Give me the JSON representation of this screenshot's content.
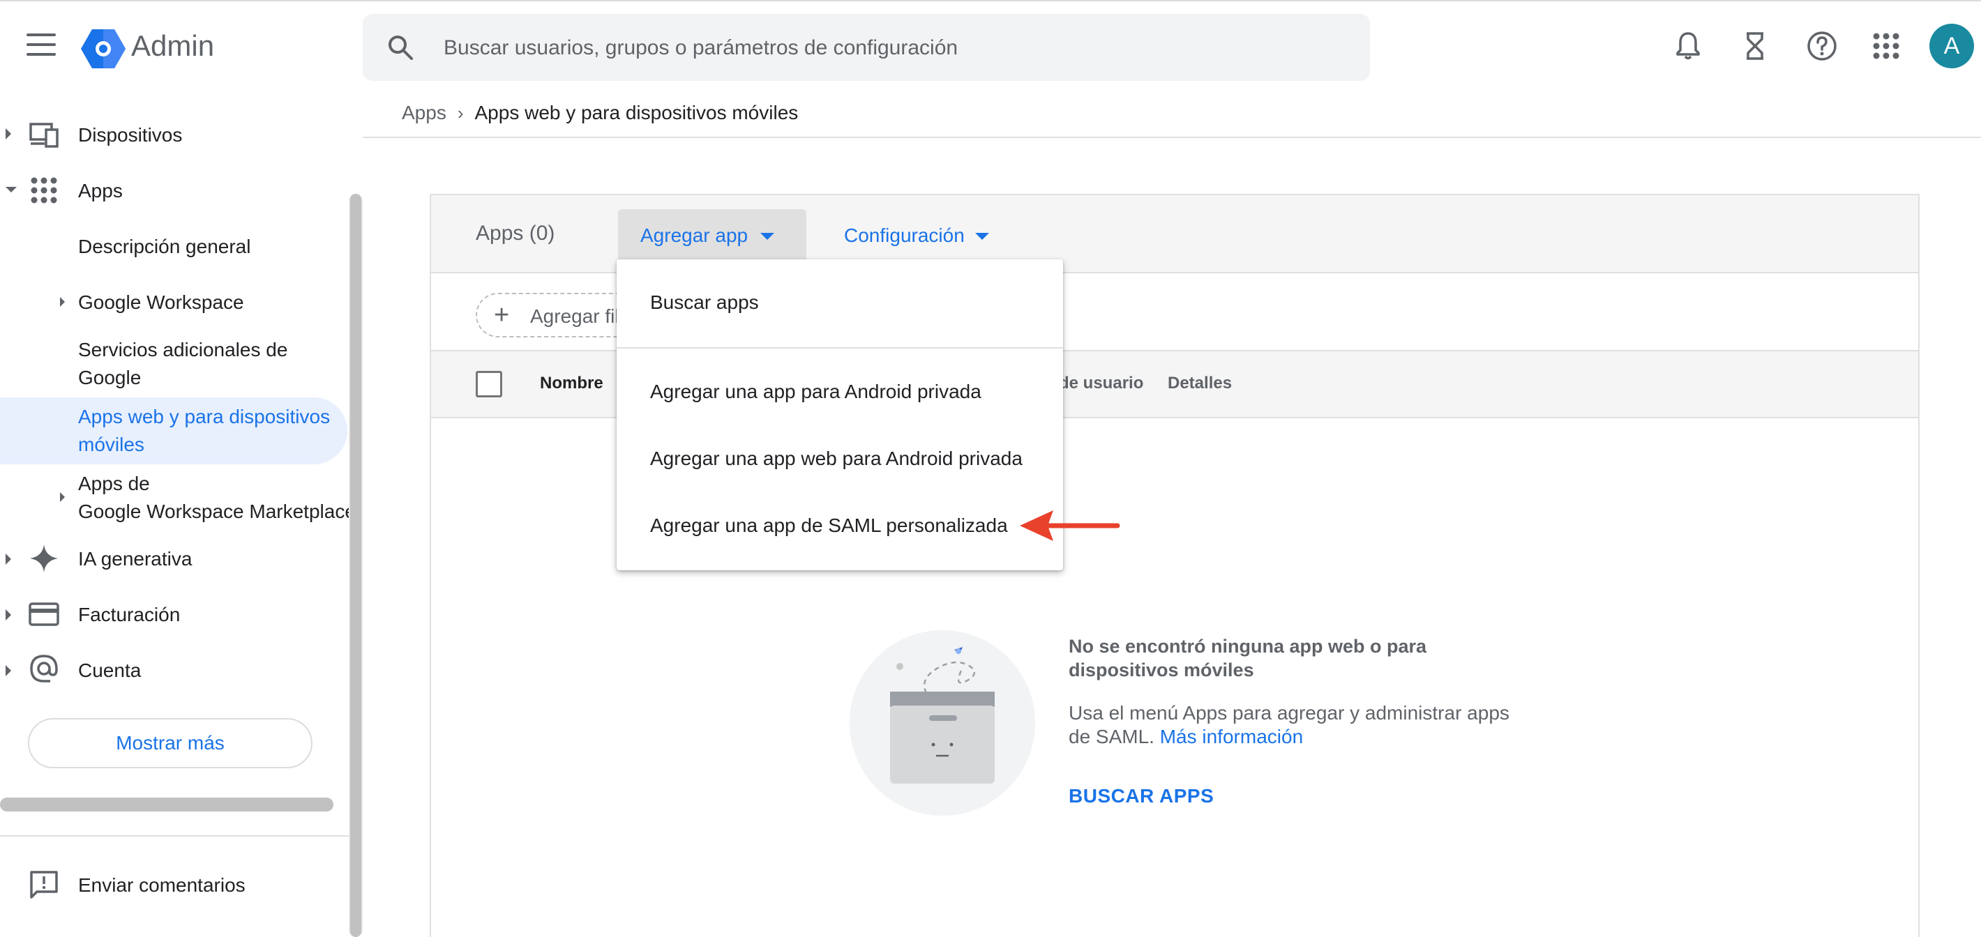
{
  "header": {
    "app_title": "Admin",
    "search_placeholder": "Buscar usuarios, grupos o parámetros de configuración",
    "avatar_letter": "A",
    "icons": [
      "menu-icon",
      "admin-logo",
      "search-icon",
      "bell-icon",
      "hourglass-icon",
      "help-icon",
      "apps-grid-icon"
    ]
  },
  "breadcrumb": {
    "items": [
      "Apps",
      "Apps web y para dispositivos móviles"
    ]
  },
  "sidebar": {
    "items": [
      {
        "label": "Dispositivos",
        "icon": "devices-icon"
      },
      {
        "label": "Apps",
        "icon": "apps-grid-icon"
      },
      {
        "label": "IA generativa",
        "icon": "sparkle-icon"
      },
      {
        "label": "Facturación",
        "icon": "credit-card-icon"
      },
      {
        "label": "Cuenta",
        "icon": "at-sign-icon"
      }
    ],
    "apps_sub": {
      "overview": "Descripción general",
      "workspace": "Google Workspace",
      "additional_line1": "Servicios adicionales de",
      "additional_line2": "Google",
      "webmobile_line1": "Apps web y para dispositivos",
      "webmobile_line2": "móviles",
      "marketplace_line1": "Apps de",
      "marketplace_line2": "Google Workspace Marketplace"
    },
    "show_more": "Mostrar más",
    "feedback": "Enviar comentarios"
  },
  "main": {
    "apps_count": "Apps (0)",
    "add_app": "Agregar app",
    "config": "Configuración",
    "filter": "Agregar filtro",
    "columns": {
      "name": "Nombre",
      "user_access": "de usuario",
      "details": "Detalles"
    }
  },
  "dropdown": {
    "items": [
      "Buscar apps",
      "Agregar una app para Android privada",
      "Agregar una app web para Android privada",
      "Agregar una app de SAML personalizada"
    ]
  },
  "empty_state": {
    "title": "No se encontró ninguna app web o para dispositivos móviles",
    "desc": "Usa el menú Apps para agregar y administrar apps de SAML.",
    "link": "Más información",
    "button": "BUSCAR APPS"
  },
  "colors": {
    "accent": "#1a73e8",
    "active_bg": "#e8f0fe",
    "arrow": "#e8412c",
    "avatar": "#1a8aa0"
  }
}
